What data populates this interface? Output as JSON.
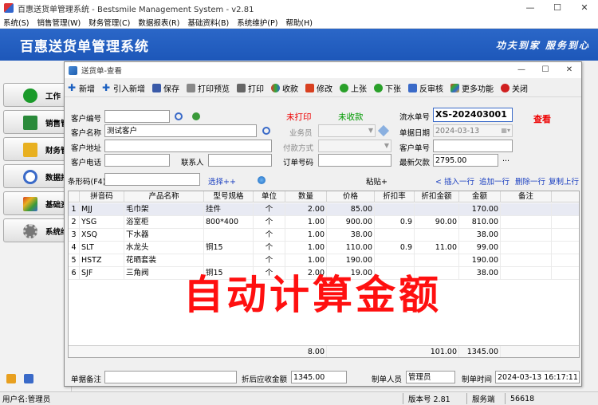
{
  "window": {
    "title": "百惠送货单管理系统 - Bestsmile Management System - v2.81",
    "controls": [
      "—",
      "☐",
      "✕"
    ]
  },
  "menu": [
    "系统(S)",
    "销售管理(W)",
    "财务管理(C)",
    "数据报表(R)",
    "基础资料(B)",
    "系统维护(P)",
    "帮助(H)"
  ],
  "banner": {
    "brand": "百惠送货单管理系统",
    "slogan": "功夫到家 服务到心"
  },
  "sidebar": {
    "items": [
      {
        "label": "工作",
        "icon": "check-icon",
        "color": "#1a9a2a"
      },
      {
        "label": "销售管",
        "icon": "sales-icon",
        "color": "#2a8a3a"
      },
      {
        "label": "财务管",
        "icon": "folder-icon",
        "color": "#e8b020"
      },
      {
        "label": "数据报",
        "icon": "magnifier-icon",
        "color": "#3a6ac8"
      },
      {
        "label": "基础资",
        "icon": "pyramid-icon",
        "color": "#d84020"
      },
      {
        "label": "系统维",
        "icon": "gear-icon",
        "color": "#666666"
      }
    ]
  },
  "status": {
    "user": "用户名:管理员",
    "version": "版本号 2.81",
    "service": "服务端",
    "port": "56618"
  },
  "child": {
    "title": "送货单-查看",
    "controls": [
      "—",
      "☐",
      "✕"
    ],
    "toolbar": [
      "新增",
      "引入新增",
      "保存",
      "打印预览",
      "打印",
      "收款",
      "修改",
      "上张",
      "下张",
      "反审核",
      "更多功能",
      "关闭"
    ],
    "form": {
      "cust_code_label": "客户编号",
      "cust_code": "",
      "cust_name_label": "客户名称",
      "cust_name": "测试客户",
      "cust_addr_label": "客户地址",
      "cust_addr": "",
      "cust_phone_label": "客户电话",
      "cust_phone": "",
      "contact_label": "联系人",
      "contact": "",
      "not_printed": "未打印",
      "not_received": "未收款",
      "salesman_label": "业务员",
      "salesman": "",
      "pay_method_label": "付款方式",
      "pay_method": "",
      "order_no_label": "订单号码",
      "order_no": "",
      "serial_label": "流水单号",
      "serial": "XS-202403001",
      "date_label": "单据日期",
      "date": "2024-03-13",
      "cust_order_label": "客户单号",
      "cust_order": "",
      "debt_label": "最新欠款",
      "debt": "2795.00",
      "view_mode": "查看",
      "barcode_label": "条形码(F4)",
      "select_more": "选择++",
      "paste_more": "粘贴+",
      "insert_row": "< 插入一行",
      "append_row": "追加一行",
      "delete_row": "删除一行",
      "copy_up": "复制上行"
    },
    "grid": {
      "headers": [
        "",
        "拼音码",
        "产品名称",
        "型号规格",
        "单位",
        "数量",
        "价格",
        "折扣率",
        "折扣金额",
        "金额",
        "备注"
      ],
      "rows": [
        [
          "1",
          "MJJ",
          "毛巾架",
          "挂件",
          "个",
          "2.00",
          "85.00",
          "",
          "",
          "170.00",
          ""
        ],
        [
          "2",
          "YSG",
          "浴室柜",
          "800*400",
          "个",
          "1.00",
          "900.00",
          "0.9",
          "90.00",
          "810.00",
          ""
        ],
        [
          "3",
          "XSQ",
          "下水器",
          "",
          "个",
          "1.00",
          "38.00",
          "",
          "",
          "38.00",
          ""
        ],
        [
          "4",
          "SLT",
          "水龙头",
          "铜15",
          "个",
          "1.00",
          "110.00",
          "0.9",
          "11.00",
          "99.00",
          ""
        ],
        [
          "5",
          "HSTZ",
          "花晒套装",
          "",
          "个",
          "1.00",
          "190.00",
          "",
          "",
          "190.00",
          ""
        ],
        [
          "6",
          "SJF",
          "三角阀",
          "铜15",
          "个",
          "2.00",
          "19.00",
          "",
          "",
          "38.00",
          ""
        ]
      ],
      "totals": {
        "qty": "8.00",
        "discount": "101.00",
        "amount": "1345.00"
      }
    },
    "footer": {
      "remark_label": "单据备注",
      "remark": "",
      "receivable_label": "折后应收金额",
      "receivable": "1345.00",
      "maker_label": "制单人员",
      "maker": "管理员",
      "time_label": "制单时间",
      "time": "2024-03-13 16:17:11"
    }
  },
  "overlay_text": "自动计算金额"
}
